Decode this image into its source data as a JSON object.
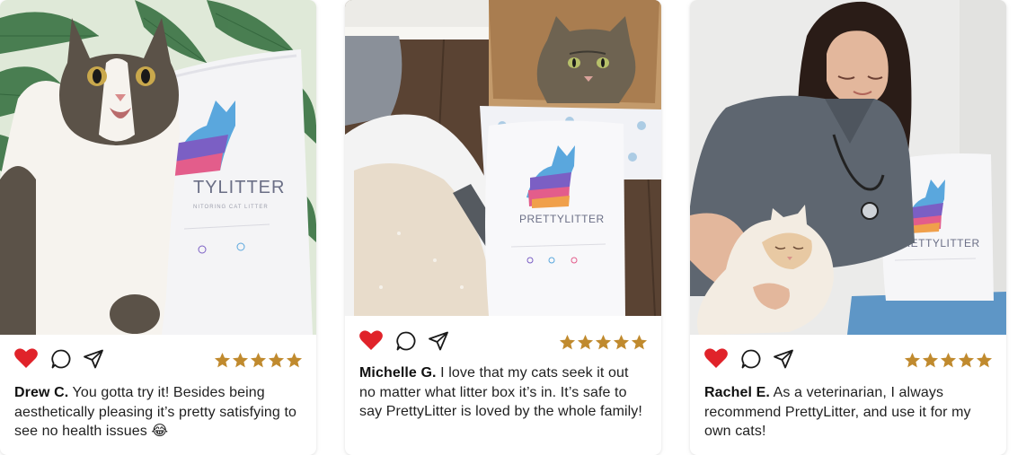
{
  "colors": {
    "heart": "#e0232a",
    "star": "#c08a2e",
    "text": "#1f1f1f"
  },
  "cards": [
    {
      "photo_icon": "cat-with-prettylitter-bag-photo",
      "brand_text": "TYLITTER",
      "rating": 5,
      "reviewer": "Drew C.",
      "review": "You gotta try it! Besides being aesthetically pleasing it’s pretty satisfying to see no health issues 😂"
    },
    {
      "photo_icon": "cat-in-box-with-prettylitter-bag-photo",
      "brand_text": "PRETTYLITTER",
      "rating": 5,
      "reviewer": "Michelle G.",
      "review": "I love that my cats seek it out no matter what litter box it’s in. It’s safe to say PrettyLitter is loved by the whole family!"
    },
    {
      "photo_icon": "veterinarian-with-cat-photo",
      "brand_text": "PRETTYLITTER",
      "rating": 5,
      "reviewer": "Rachel E.",
      "review": "As a veterinarian, I always recommend PrettyLitter, and use it for my own cats!"
    }
  ]
}
